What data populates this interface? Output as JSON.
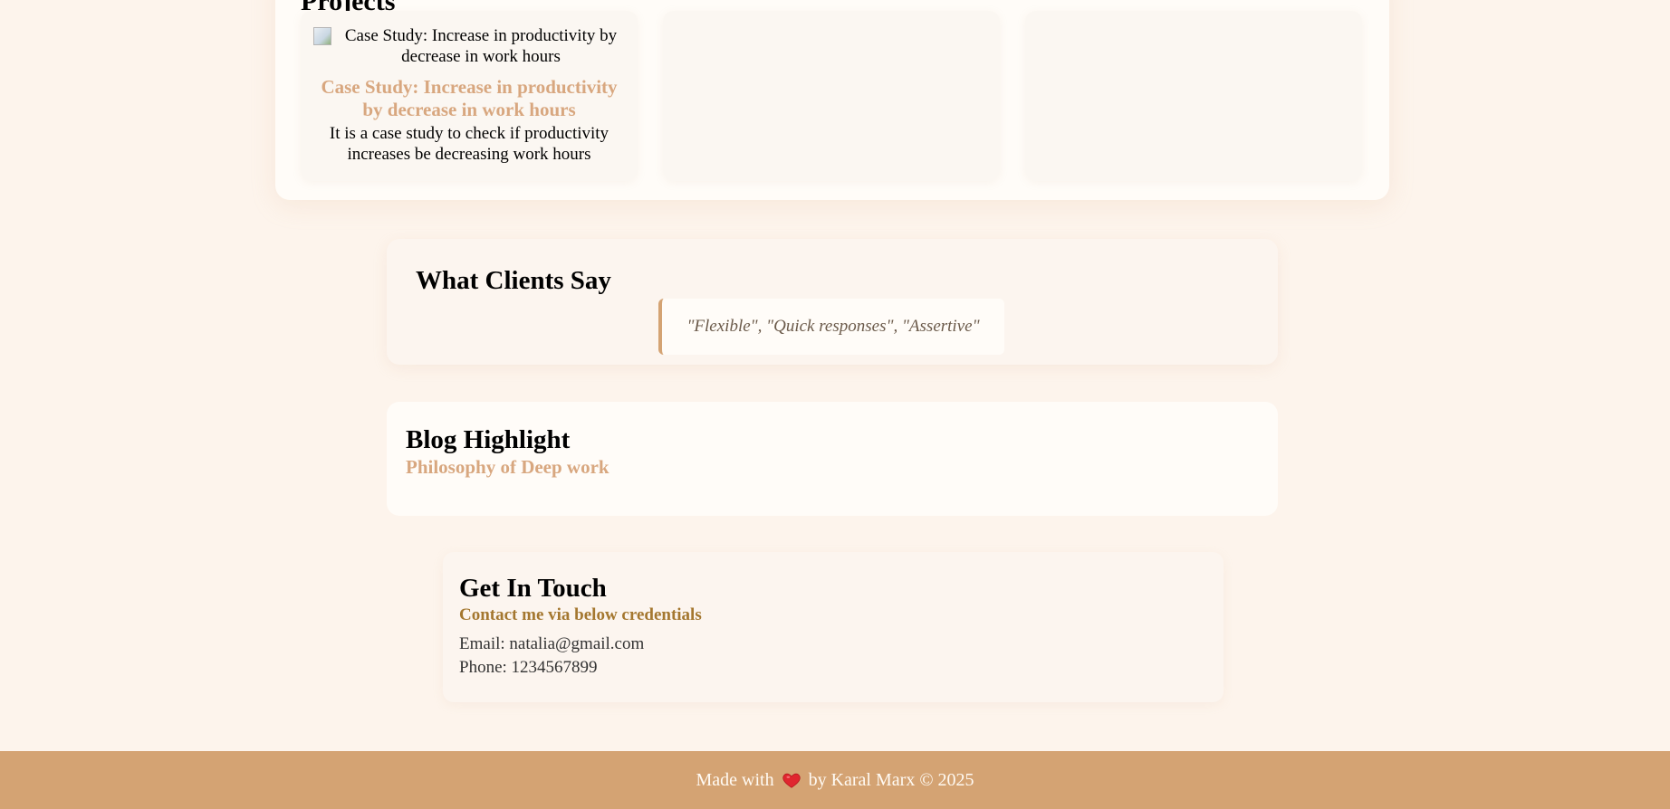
{
  "projects": {
    "heading": "Projects",
    "cards": [
      {
        "image_alt": "Case Study: Increase in productivity by decrease in work hours",
        "title": "Case Study: Increase in productivity by decrease in work hours",
        "description": "It is a case study to check if productivity increases be decreasing work hours"
      },
      {},
      {}
    ]
  },
  "testimonials": {
    "heading": "What Clients Say",
    "quote": "\"Flexible\", \"Quick responses\", \"Assertive\"",
    "accent_color": "#d4a373"
  },
  "blog": {
    "heading": "Blog Highlight",
    "link_text": "Philosophy of Deep work",
    "link_color": "#d8a77f"
  },
  "contact": {
    "heading": "Get In Touch",
    "subheading": "Contact me via below credentials",
    "email_line": "Email: natalia@gmail.com",
    "phone_line": "Phone: 1234567899"
  },
  "footer": {
    "made_with": "Made with",
    "icon": "heart-icon",
    "by_text": "by Karal Marx © 2025",
    "background_color": "#d4a373"
  }
}
